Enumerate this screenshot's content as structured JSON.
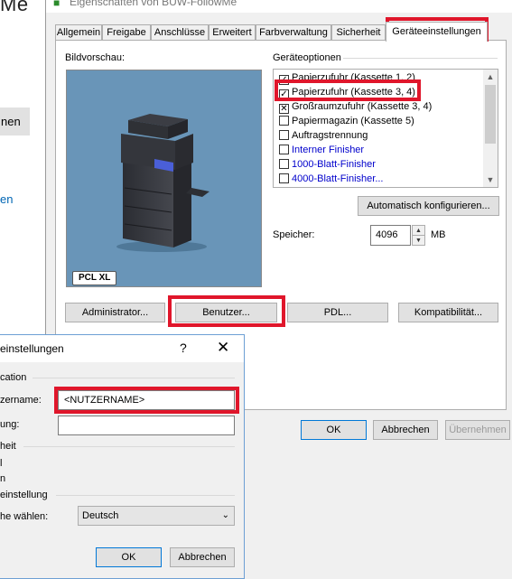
{
  "background": {
    "title_fragment": "Me",
    "button_fragment": "nen",
    "link_fragment": "en"
  },
  "props_dialog": {
    "title": "Eigenschaften von BUW-FollowMe",
    "tabs": [
      {
        "label": "Allgemein"
      },
      {
        "label": "Freigabe"
      },
      {
        "label": "Anschlüsse"
      },
      {
        "label": "Erweitert"
      },
      {
        "label": "Farbverwaltung"
      },
      {
        "label": "Sicherheit"
      },
      {
        "label": "Geräteeinstellungen"
      }
    ],
    "active_tab": "Geräteeinstellungen",
    "preview_label": "Bildvorschau:",
    "preview_badge": "PCL XL",
    "options_label": "Geräteoptionen",
    "options": [
      {
        "label": "Papierzufuhr (Kassette 1, 2)",
        "state": "checked",
        "color": "#000000"
      },
      {
        "label": "Papierzufuhr (Kassette 3, 4)",
        "state": "checked",
        "color": "#000000"
      },
      {
        "label": "Großraumzufuhr (Kassette 3, 4)",
        "state": "x",
        "color": "#000000"
      },
      {
        "label": "Papiermagazin (Kassette 5)",
        "state": "unchecked",
        "color": "#000000"
      },
      {
        "label": "Auftragstrennung",
        "state": "unchecked",
        "color": "#000000"
      },
      {
        "label": "Interner Finisher",
        "state": "unchecked",
        "color": "#0000cc"
      },
      {
        "label": "1000-Blatt-Finisher",
        "state": "unchecked",
        "color": "#0000cc"
      },
      {
        "label": "4000-Blatt-Finisher...",
        "state": "unchecked",
        "color": "#0000cc"
      }
    ],
    "auto_config_button": "Automatisch konfigurieren...",
    "memory_label": "Speicher:",
    "memory_value": "4096",
    "memory_unit": "MB",
    "buttons": {
      "administrator": "Administrator...",
      "user": "Benutzer...",
      "pdl": "PDL...",
      "compat": "Kompatibilität..."
    },
    "footer": {
      "ok": "OK",
      "cancel": "Abbrechen",
      "apply": "Übernehmen"
    }
  },
  "user_dialog": {
    "title": "einstellungen",
    "help": "?",
    "close": "✕",
    "section_auth": "cation",
    "username_label": "zername:",
    "username_value": "<NUTZERNAME>",
    "password_label": "ung:",
    "password_value": "",
    "section_unit": "heit",
    "frag_1": "l",
    "frag_2": "n",
    "section_lang": "einstellung",
    "lang_label": "he wählen:",
    "lang_value": "Deutsch",
    "ok": "OK",
    "cancel": "Abbrechen"
  },
  "highlight_color": "#e0162b"
}
